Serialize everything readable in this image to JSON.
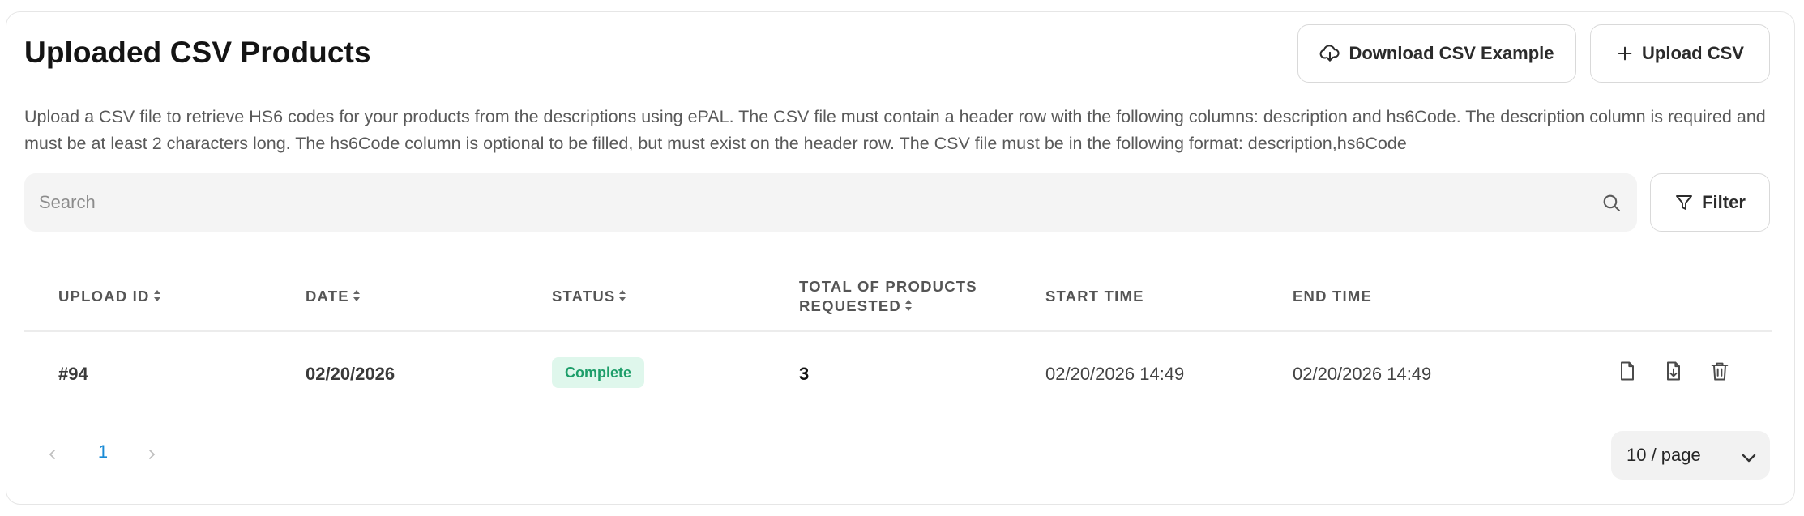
{
  "header": {
    "title": "Uploaded CSV Products",
    "download_button": {
      "label": "Download CSV Example",
      "icon": "cloud-download-icon"
    },
    "upload_button": {
      "label": "Upload CSV",
      "icon": "plus-icon"
    }
  },
  "description": "Upload a CSV file to retrieve HS6 codes for your products from the descriptions using ePAL. The CSV file must contain a header row with the following columns: description and hs6Code. The description column is required and must be at least 2 characters long. The hs6Code column is optional to be filled, but must exist on the header row. The CSV file must be in the following format: description,hs6Code",
  "search": {
    "placeholder": "Search",
    "value": "",
    "icon": "search-icon"
  },
  "filter_button": {
    "label": "Filter",
    "icon": "filter-icon"
  },
  "table": {
    "columns": [
      {
        "label": "UPLOAD ID",
        "sortable": true
      },
      {
        "label": "DATE",
        "sortable": true
      },
      {
        "label": "STATUS",
        "sortable": true
      },
      {
        "label_line1": "TOTAL OF PRODUCTS",
        "label_line2": "REQUESTED",
        "sortable": true
      },
      {
        "label": "START TIME",
        "sortable": false
      },
      {
        "label": "END TIME",
        "sortable": false
      }
    ],
    "rows": [
      {
        "upload_id": "#94",
        "date": "02/20/2026",
        "status": "Complete",
        "total": "3",
        "start_time": "02/20/2026 14:49",
        "end_time": "02/20/2026 14:49",
        "actions": [
          "file-icon",
          "file-download-icon",
          "trash-icon"
        ]
      }
    ]
  },
  "pagination": {
    "current_page": "1",
    "page_size": "10 / page"
  },
  "colors": {
    "status_complete_bg": "#dff7ec",
    "status_complete_text": "#1e9e6a",
    "active_page": "#1a8bd6"
  }
}
